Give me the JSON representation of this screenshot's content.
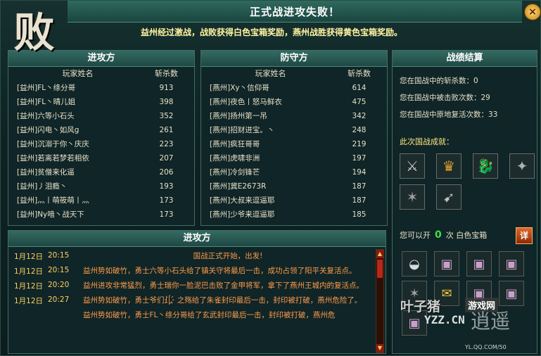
{
  "window": {
    "defeat_glyph": "败",
    "title": "正式战进攻失败！",
    "close_label": "×",
    "reward_message": "益州经过激战，战败获得白色宝箱奖励，燕州战胜获得黄色宝箱奖励。"
  },
  "attackers": {
    "title": "进攻方",
    "col_name": "玩家姓名",
    "col_kills": "斩杀数",
    "rows": [
      {
        "name": "[益州]FL丶绦分哥",
        "kills": "913"
      },
      {
        "name": "[益州]FL丶晴儿姐",
        "kills": "398"
      },
      {
        "name": "[益州]六等小石头",
        "kills": "352"
      },
      {
        "name": "[益州]闪电丶如风g",
        "kills": "261"
      },
      {
        "name": "[益州]沉溺于你丶庆庆",
        "kills": "223"
      },
      {
        "name": "[益州]若离若梦若相依",
        "kills": "207"
      },
      {
        "name": "[益州]贫僧来化逼",
        "kills": "206"
      },
      {
        "name": "[益州]丿泪瘾丶",
        "kills": "193"
      },
      {
        "name": "[益州]灬丨萌筱萌丨灬",
        "kills": "173"
      },
      {
        "name": "[益州]Ny喑丶战天下",
        "kills": "173"
      }
    ]
  },
  "defenders": {
    "title": "防守方",
    "col_name": "玩家姓名",
    "col_kills": "斩杀数",
    "rows": [
      {
        "name": "[燕州]Xy丶信仰哥",
        "kills": "614"
      },
      {
        "name": "[燕州]夜色丨怒马鲜衣",
        "kills": "475"
      },
      {
        "name": "[燕州]扬州第一吊",
        "kills": "342"
      },
      {
        "name": "[燕州]招财进宝。丶",
        "kills": "248"
      },
      {
        "name": "[燕州]疯狂哥哥",
        "kills": "219"
      },
      {
        "name": "[燕州]虎啸非洲",
        "kills": "197"
      },
      {
        "name": "[燕州]冷剑锋芒",
        "kills": "194"
      },
      {
        "name": "[燕州]冀E2673R",
        "kills": "187"
      },
      {
        "name": "[燕州]大叔来逗逼耶",
        "kills": "187"
      },
      {
        "name": "[燕州]少爷来逗逼耶",
        "kills": "185"
      }
    ]
  },
  "summary": {
    "title": "战绩结算",
    "kills_line": "您在国战中的斩杀数：0",
    "deaths_line": "您在国战中被击败次数：29",
    "revives_line": "您在国战中原地复活次数：33",
    "achievements_title": "此次国战成就：",
    "achievements": [
      "sword-cross-icon",
      "general-icon",
      "dragon-icon",
      "shadow-blade-icon",
      "claw-icon",
      "spear-icon"
    ],
    "chest_prefix": "您可以开",
    "chest_count": "0",
    "chest_suffix": "次 白色宝箱",
    "detail_label": "详"
  },
  "log": {
    "title": "进攻方",
    "entries": [
      {
        "date": "1月12日",
        "time": "20:15",
        "text": "国战正式开始，出发!",
        "center": true
      },
      {
        "date": "1月12日",
        "time": "20:15",
        "text": "益州势如破竹，勇士六等小石头给了镇关守将最后一击，成功占领了阳平关复活点。"
      },
      {
        "date": "1月12日",
        "time": "20:20",
        "text": "益州进攻非常猛烈，勇士瑞你一脸泥巴击败了金甲将军，拿下了燕州王城内的复活点。"
      },
      {
        "date": "1月12日",
        "time": "20:27",
        "text": "益州势如破竹，勇士爷们儿҉ 之殇给了朱雀封印最后一击，封印被打破，燕州危险了。"
      },
      {
        "date": "",
        "time": "",
        "text": "益州势如破竹，勇士FL丶绦分哥给了玄武封印最后一击，封印被打破，燕州危"
      }
    ]
  },
  "chests": [
    "silver-ingot-icon",
    "chest-icon",
    "chest-icon",
    "chest-icon",
    "claw-icon",
    "gold-bag-icon",
    "chest-icon",
    "chest-icon",
    "chest-icon"
  ],
  "watermark": {
    "site_a": "叶子猪",
    "site_b": "游戏网",
    "url": "YZZ.CN",
    "brand": "逍遥",
    "sub_url": "YL.QQ.COM/50"
  }
}
